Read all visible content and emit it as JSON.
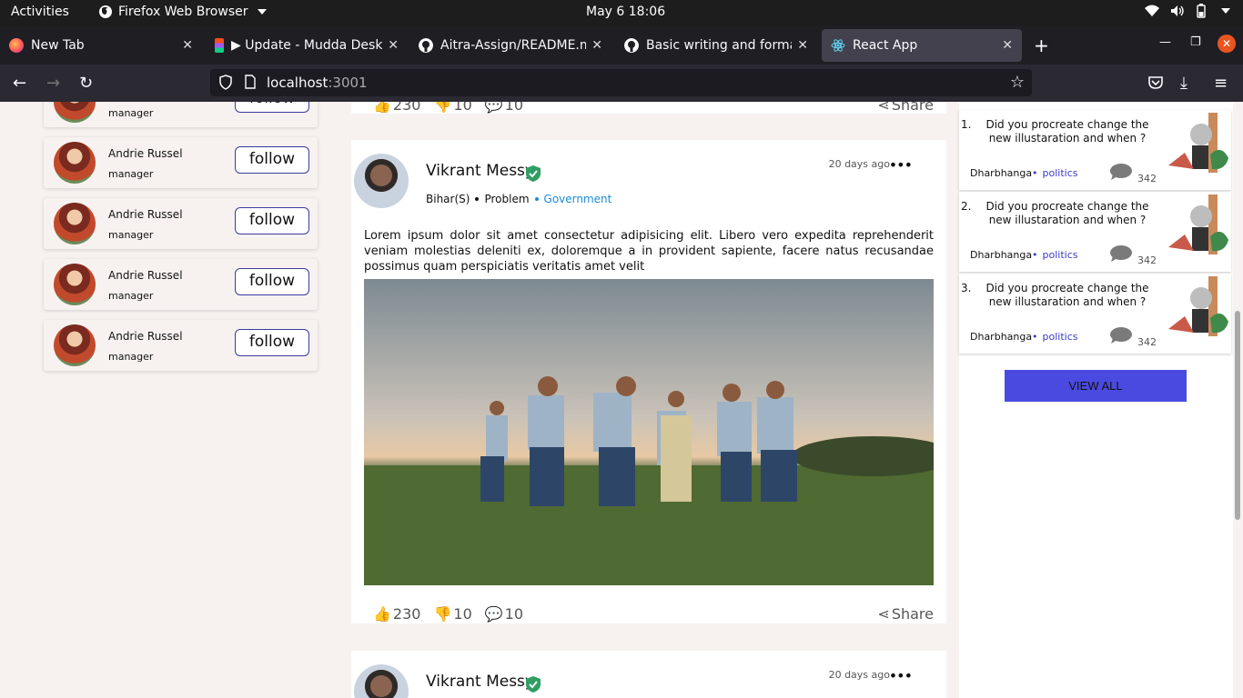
{
  "system": {
    "activities": "Activities",
    "app_name": "Firefox Web Browser",
    "clock": "May 6  18:06"
  },
  "tabs": [
    {
      "title": "New Tab",
      "icon": "firefox-icon"
    },
    {
      "title": "▶ Update - Mudda Desktop",
      "icon": "figma-icon"
    },
    {
      "title": "Aitra-Assign/README.md",
      "icon": "github-icon"
    },
    {
      "title": "Basic writing and formatting",
      "icon": "github-icon"
    },
    {
      "title": "React App",
      "icon": "react-icon",
      "active": true
    }
  ],
  "navbar": {
    "url_host": "localhost",
    "url_port": ":3001"
  },
  "people": [
    {
      "name": "Andrie Russel",
      "role": "manager",
      "button": "follow"
    },
    {
      "name": "Andrie Russel",
      "role": "manager",
      "button": "follow"
    },
    {
      "name": "Andrie Russel",
      "role": "manager",
      "button": "follow"
    },
    {
      "name": "Andrie Russel",
      "role": "manager",
      "button": "follow"
    }
  ],
  "partial_person": {
    "role": "manager",
    "button": "follow"
  },
  "post_top": {
    "likes": "230",
    "dislikes": "10",
    "comments": "10",
    "share": "Share"
  },
  "post_main": {
    "author": "Vikrant Messy",
    "date": "20 days ago",
    "menu": "•••",
    "location": "Bihar(S)",
    "type": "Problem",
    "category": "Government",
    "text": "Lorem ipsum dolor sit amet consectetur adipisicing elit. Libero vero expedita reprehenderit veniam molestias deleniti ex, doloremque a in provident sapiente, facere natus recusandae possimus quam perspiciatis veritatis amet velit",
    "likes": "230",
    "dislikes": "10",
    "comments": "10",
    "share": "Share"
  },
  "post_next": {
    "author": "Vikrant Messy",
    "date": "20 days ago",
    "menu": "•••"
  },
  "questions": [
    {
      "num": "1.",
      "text": "Did you procreate change the new illustaration and when ?",
      "location": "Dharbhanga",
      "category": "politics",
      "count": "342"
    },
    {
      "num": "2.",
      "text": "Did you procreate change the new illustaration and when ?",
      "location": "Dharbhanga",
      "category": "politics",
      "count": "342"
    },
    {
      "num": "3.",
      "text": "Did you procreate change the new illustaration and when ?",
      "location": "Dharbhanga",
      "category": "politics",
      "count": "342"
    }
  ],
  "view_all": "VIEW ALL",
  "colors": {
    "accent": "#4a4ae0",
    "link_blue": "#1b8bd6",
    "category_purple": "#3a3ac9",
    "follow_border": "#3a3a9c"
  }
}
